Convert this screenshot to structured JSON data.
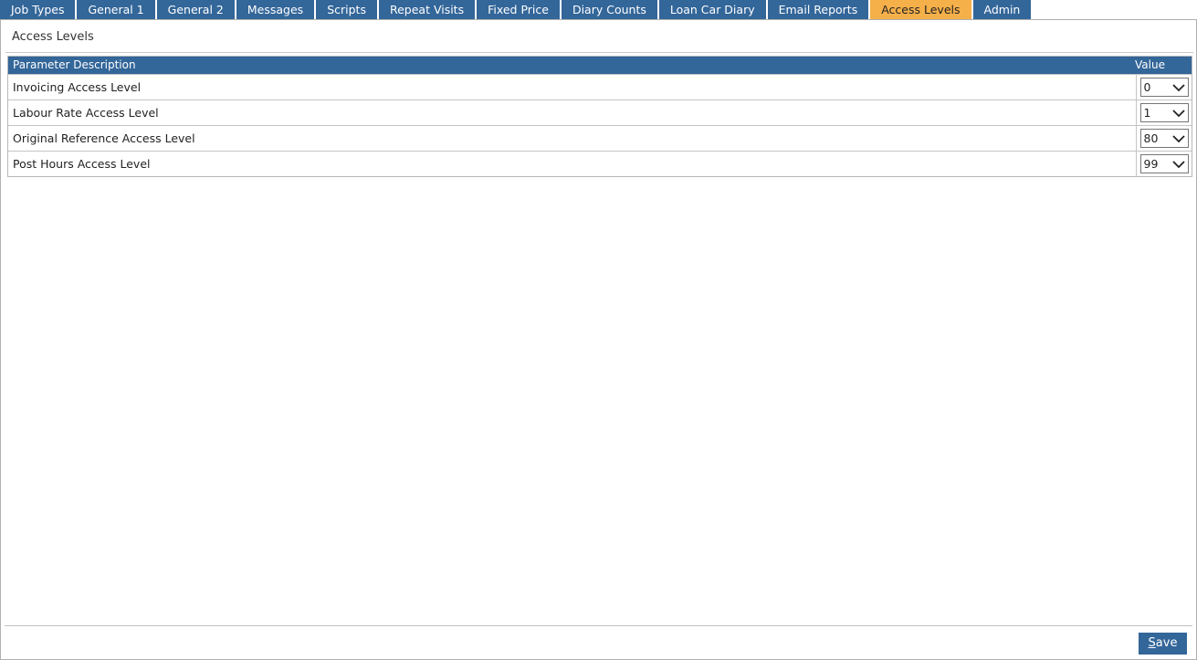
{
  "tabs": [
    {
      "label": "Job Types",
      "active": false
    },
    {
      "label": "General 1",
      "active": false
    },
    {
      "label": "General 2",
      "active": false
    },
    {
      "label": "Messages",
      "active": false
    },
    {
      "label": "Scripts",
      "active": false
    },
    {
      "label": "Repeat Visits",
      "active": false
    },
    {
      "label": "Fixed Price",
      "active": false
    },
    {
      "label": "Diary Counts",
      "active": false
    },
    {
      "label": "Loan Car Diary",
      "active": false
    },
    {
      "label": "Email Reports",
      "active": false
    },
    {
      "label": "Access Levels",
      "active": true
    },
    {
      "label": "Admin",
      "active": false
    }
  ],
  "section": {
    "title": "Access Levels"
  },
  "grid": {
    "headers": {
      "description": "Parameter Description",
      "value": "Value"
    },
    "rows": [
      {
        "description": "Invoicing Access Level",
        "value": "0"
      },
      {
        "description": "Labour Rate Access Level",
        "value": "1"
      },
      {
        "description": "Original Reference Access Level",
        "value": "80"
      },
      {
        "description": "Post Hours Access Level",
        "value": "99"
      }
    ]
  },
  "footer": {
    "save_hotkey": "S",
    "save_rest": "ave"
  },
  "colors": {
    "tab": "#336699",
    "tab_active": "#f5b04a",
    "header": "#336699",
    "button": "#336699"
  }
}
